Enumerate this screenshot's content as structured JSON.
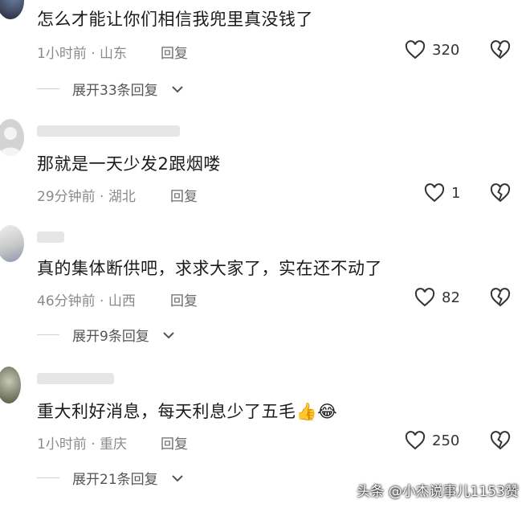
{
  "comments": [
    {
      "text": "怎么才能让你们相信我兜里真没钱了",
      "time": "1小时前",
      "location": "山东",
      "reply_label": "回复",
      "likes": "320",
      "expand_label": "展开33条回复"
    },
    {
      "text": "那就是一天少发2跟烟喽",
      "time": "29分钟前",
      "location": "湖北",
      "reply_label": "回复",
      "likes": "1"
    },
    {
      "text": "真的集体断供吧，求求大家了，实在还不动了",
      "time": "46分钟前",
      "location": "山西",
      "reply_label": "回复",
      "likes": "82",
      "expand_label": "展开9条回复"
    },
    {
      "text": "重大利好消息，每天利息少了五毛👍😂",
      "time": "1小时前",
      "location": "重庆",
      "reply_label": "回复",
      "likes": "250",
      "expand_label": "展开21条回复"
    }
  ],
  "separator": "·",
  "watermark": "头条 @小杰说事儿1153赞",
  "colors": {
    "text": "#1b1b1b",
    "meta": "#8a8a8a",
    "background": "#ffffff"
  },
  "icons": {
    "like": "heart-outline-icon",
    "dislike": "broken-heart-icon",
    "expand": "chevron-down-icon"
  }
}
